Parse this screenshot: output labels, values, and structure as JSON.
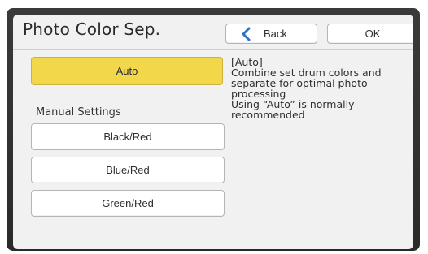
{
  "title": "Photo Color Sep.",
  "header": {
    "back_label": "Back",
    "ok_label": "OK"
  },
  "auto": {
    "label": "Auto"
  },
  "manual": {
    "section_label": "Manual Settings",
    "options": [
      "Black/Red",
      "Blue/Red",
      "Green/Red"
    ]
  },
  "description": {
    "heading": "[Auto]",
    "lines": [
      "Combine set drum colors and",
      "separate for optimal photo",
      "processing",
      "Using “Auto” is normally",
      "recommended"
    ]
  },
  "colors": {
    "accent_yellow": "#f2d74a",
    "back_chevron": "#2f73c7"
  },
  "icons": {
    "back": "chevron-left-icon"
  }
}
